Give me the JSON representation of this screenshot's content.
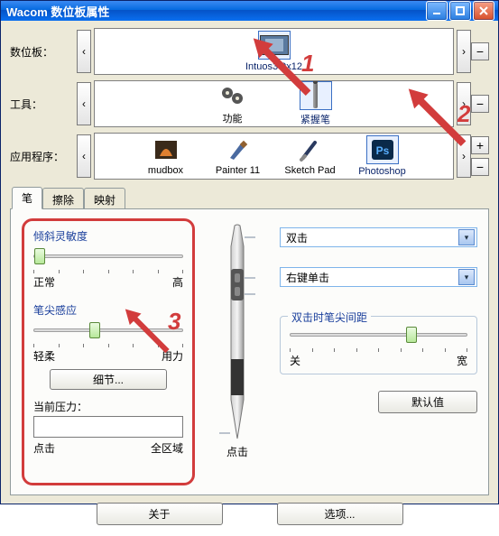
{
  "window": {
    "title": "Wacom 数位板属性"
  },
  "labels": {
    "tablet": "数位板：",
    "tool": "工具：",
    "application": "应用程序："
  },
  "tablet_items": [
    {
      "id": "intuos3",
      "label": "Intuos3 9x12",
      "selected": true
    }
  ],
  "tool_items": [
    {
      "id": "functions",
      "label": "功能"
    },
    {
      "id": "grip-pen",
      "label": "紧握笔",
      "selected": true
    }
  ],
  "app_items": [
    {
      "id": "mudbox",
      "label": "mudbox"
    },
    {
      "id": "painter",
      "label": "Painter 11"
    },
    {
      "id": "sketch",
      "label": "Sketch Pad"
    },
    {
      "id": "photoshop",
      "label": "Photoshop",
      "selected": true
    }
  ],
  "tabs": [
    {
      "id": "pen",
      "label": "笔",
      "active": true
    },
    {
      "id": "eraser",
      "label": "擦除"
    },
    {
      "id": "mapping",
      "label": "映射"
    }
  ],
  "tilt": {
    "heading": "倾斜灵敏度",
    "min_label": "正常",
    "max_label": "高",
    "value": 0,
    "min": 0,
    "max": 10
  },
  "tip": {
    "heading": "笔尖感应",
    "min_label": "轻柔",
    "max_label": "用力",
    "value": 4,
    "min": 0,
    "max": 10,
    "detail_button": "细节...",
    "current_label": "当前压力：",
    "click_label": "点击",
    "full_label": "全区域"
  },
  "pen_col": {
    "click_label": "点击"
  },
  "right": {
    "top_select": "双击",
    "mid_select": "右键单击",
    "dist_heading": "双击时笔尖间距",
    "dist_min": "关",
    "dist_max": "宽",
    "dist_value": 7,
    "dist_min_v": 0,
    "dist_max_v": 10,
    "default_btn": "默认值"
  },
  "bottom": {
    "about": "关于",
    "options": "选项..."
  },
  "annotations": {
    "n1": "1",
    "n2": "2",
    "n3": "3"
  },
  "glyphs": {
    "plus": "+",
    "minus": "−",
    "left": "‹",
    "right": "›",
    "dd": "▾"
  }
}
